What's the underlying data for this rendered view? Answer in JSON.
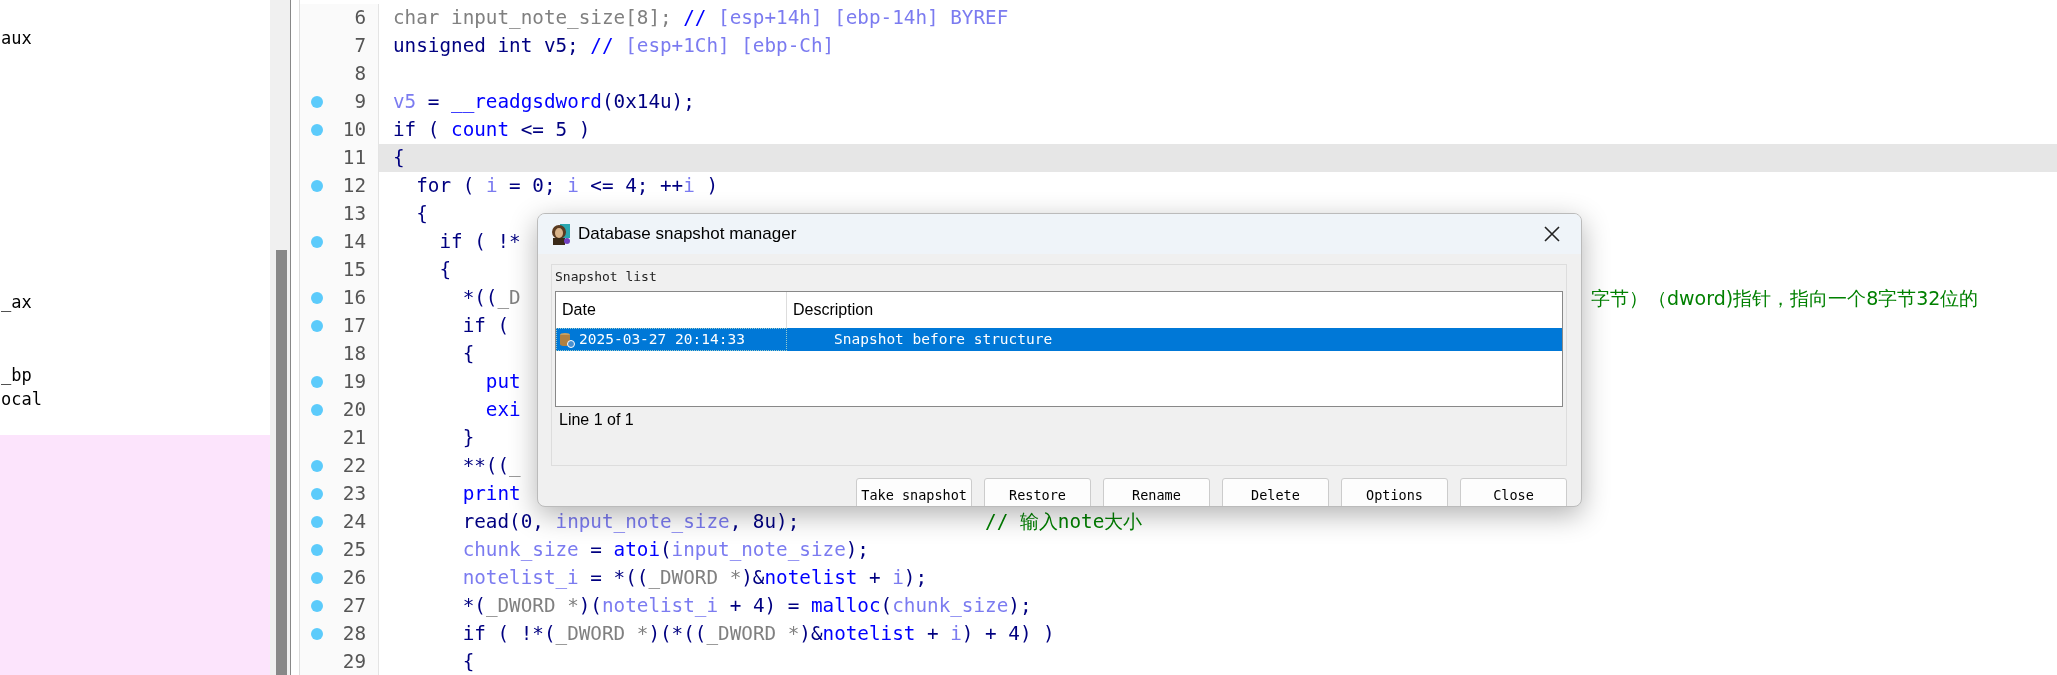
{
  "side_panel": {
    "items": [
      {
        "text": "aux"
      },
      {
        "text": "_ax"
      },
      {
        "text": "_bp"
      },
      {
        "text": "ocal"
      }
    ]
  },
  "code": {
    "lines": [
      {
        "number": "6",
        "breakpoint": false,
        "current": false,
        "segments": [
          {
            "text": "char input_note_size[8]; ",
            "kind": "type"
          },
          {
            "text": "// ",
            "kind": "func"
          },
          {
            "text": "[esp+14h] [ebp-14h] BYREF",
            "kind": "var"
          }
        ]
      },
      {
        "number": "7",
        "breakpoint": false,
        "current": false,
        "segments": [
          {
            "text": "unsigned int v5; ",
            "kind": "code"
          },
          {
            "text": "// ",
            "kind": "func"
          },
          {
            "text": "[esp+1Ch] [ebp-Ch]",
            "kind": "var"
          }
        ]
      },
      {
        "number": "8",
        "breakpoint": false,
        "current": false
      },
      {
        "number": "9",
        "breakpoint": true,
        "current": false,
        "segments": [
          {
            "text": "v5",
            "kind": "var"
          },
          {
            "text": " = ",
            "kind": "code"
          },
          {
            "text": "__readgsdword",
            "kind": "func"
          },
          {
            "text": "(0x14u);",
            "kind": "code"
          }
        ]
      },
      {
        "number": "10",
        "breakpoint": true,
        "current": false,
        "segments": [
          {
            "text": "if ( ",
            "kind": "code"
          },
          {
            "text": "count",
            "kind": "func"
          },
          {
            "text": " <= 5 )",
            "kind": "code"
          }
        ]
      },
      {
        "number": "11",
        "breakpoint": false,
        "current": true,
        "segments": [
          {
            "text": "{",
            "kind": "code"
          }
        ]
      },
      {
        "number": "12",
        "breakpoint": true,
        "current": false,
        "segments": [
          {
            "text": "  for ( ",
            "kind": "code"
          },
          {
            "text": "i",
            "kind": "var"
          },
          {
            "text": " = 0; ",
            "kind": "code"
          },
          {
            "text": "i",
            "kind": "var"
          },
          {
            "text": " <= 4; ++",
            "kind": "code"
          },
          {
            "text": "i",
            "kind": "var"
          },
          {
            "text": " )",
            "kind": "code"
          }
        ]
      },
      {
        "number": "13",
        "breakpoint": false,
        "current": false,
        "segments": [
          {
            "text": "  {",
            "kind": "code"
          }
        ]
      },
      {
        "number": "14",
        "breakpoint": true,
        "current": false,
        "segments": [
          {
            "text": "    if ( !*",
            "kind": "code"
          }
        ]
      },
      {
        "number": "15",
        "breakpoint": false,
        "current": false,
        "segments": [
          {
            "text": "    {",
            "kind": "code"
          }
        ]
      },
      {
        "number": "16",
        "breakpoint": true,
        "current": false,
        "segments": [
          {
            "text": "      *((",
            "kind": "code"
          },
          {
            "text": "_D",
            "kind": "type"
          }
        ],
        "tail": {
          "text": "字节）（dword)指针，指向一个8字节32位的",
          "kind": "comment"
        }
      },
      {
        "number": "17",
        "breakpoint": true,
        "current": false,
        "segments": [
          {
            "text": "      if (",
            "kind": "code"
          }
        ]
      },
      {
        "number": "18",
        "breakpoint": false,
        "current": false,
        "segments": [
          {
            "text": "      {",
            "kind": "code"
          }
        ]
      },
      {
        "number": "19",
        "breakpoint": true,
        "current": false,
        "segments": [
          {
            "text": "        put",
            "kind": "func"
          }
        ]
      },
      {
        "number": "20",
        "breakpoint": true,
        "current": false,
        "segments": [
          {
            "text": "        exi",
            "kind": "func"
          }
        ]
      },
      {
        "number": "21",
        "breakpoint": false,
        "current": false,
        "segments": [
          {
            "text": "      }",
            "kind": "code"
          }
        ]
      },
      {
        "number": "22",
        "breakpoint": true,
        "current": false,
        "segments": [
          {
            "text": "      **((",
            "kind": "code"
          },
          {
            "text": "_",
            "kind": "type"
          }
        ]
      },
      {
        "number": "23",
        "breakpoint": true,
        "current": false,
        "segments": [
          {
            "text": "      print",
            "kind": "func"
          }
        ]
      },
      {
        "number": "24",
        "breakpoint": true,
        "current": false,
        "segments": [
          {
            "text": "      read(0, ",
            "kind": "code"
          },
          {
            "text": "input_note_size",
            "kind": "var"
          },
          {
            "text": ", 8u);",
            "kind": "code"
          },
          {
            "text": "// 输入note大小",
            "kind": "comment"
          }
        ]
      },
      {
        "number": "25",
        "breakpoint": true,
        "current": false,
        "segments": [
          {
            "text": "      chunk_size",
            "kind": "var"
          },
          {
            "text": " = ",
            "kind": "code"
          },
          {
            "text": "atoi",
            "kind": "func"
          },
          {
            "text": "(",
            "kind": "code"
          },
          {
            "text": "input_note_size",
            "kind": "var"
          },
          {
            "text": ");",
            "kind": "code"
          }
        ]
      },
      {
        "number": "26",
        "breakpoint": true,
        "current": false,
        "segments": [
          {
            "text": "      notelist_i",
            "kind": "var"
          },
          {
            "text": " = *((",
            "kind": "code"
          },
          {
            "text": "_DWORD *",
            "kind": "type"
          },
          {
            "text": ")&",
            "kind": "code"
          },
          {
            "text": "notelist",
            "kind": "func"
          },
          {
            "text": " + ",
            "kind": "code"
          },
          {
            "text": "i",
            "kind": "var"
          },
          {
            "text": ");",
            "kind": "code"
          }
        ]
      },
      {
        "number": "27",
        "breakpoint": true,
        "current": false,
        "segments": [
          {
            "text": "      *(",
            "kind": "code"
          },
          {
            "text": "_DWORD *",
            "kind": "type"
          },
          {
            "text": ")(",
            "kind": "code"
          },
          {
            "text": "notelist_i",
            "kind": "var"
          },
          {
            "text": " + 4) = ",
            "kind": "code"
          },
          {
            "text": "malloc",
            "kind": "func"
          },
          {
            "text": "(",
            "kind": "code"
          },
          {
            "text": "chunk_size",
            "kind": "var"
          },
          {
            "text": ");",
            "kind": "code"
          }
        ]
      },
      {
        "number": "28",
        "breakpoint": true,
        "current": false,
        "segments": [
          {
            "text": "      if ( !*(",
            "kind": "code"
          },
          {
            "text": "_DWORD *",
            "kind": "type"
          },
          {
            "text": ")(*((",
            "kind": "code"
          },
          {
            "text": "_DWORD *",
            "kind": "type"
          },
          {
            "text": ")&",
            "kind": "code"
          },
          {
            "text": "notelist",
            "kind": "func"
          },
          {
            "text": " + ",
            "kind": "code"
          },
          {
            "text": "i",
            "kind": "var"
          },
          {
            "text": ") + 4) )",
            "kind": "code"
          }
        ]
      },
      {
        "number": "29",
        "breakpoint": false,
        "current": false,
        "segments": [
          {
            "text": "      {",
            "kind": "code"
          }
        ]
      }
    ]
  },
  "dialog": {
    "title": "Database snapshot manager",
    "group_label": "Snapshot list",
    "columns": [
      "Date",
      "Description"
    ],
    "rows": [
      {
        "date": "2025-03-27 20:14:33",
        "description": "Snapshot before structure",
        "selected": true
      }
    ],
    "status": "Line 1 of 1",
    "buttons": [
      "Take snapshot",
      "Restore",
      "Rename",
      "Delete",
      "Options",
      "Close"
    ]
  }
}
